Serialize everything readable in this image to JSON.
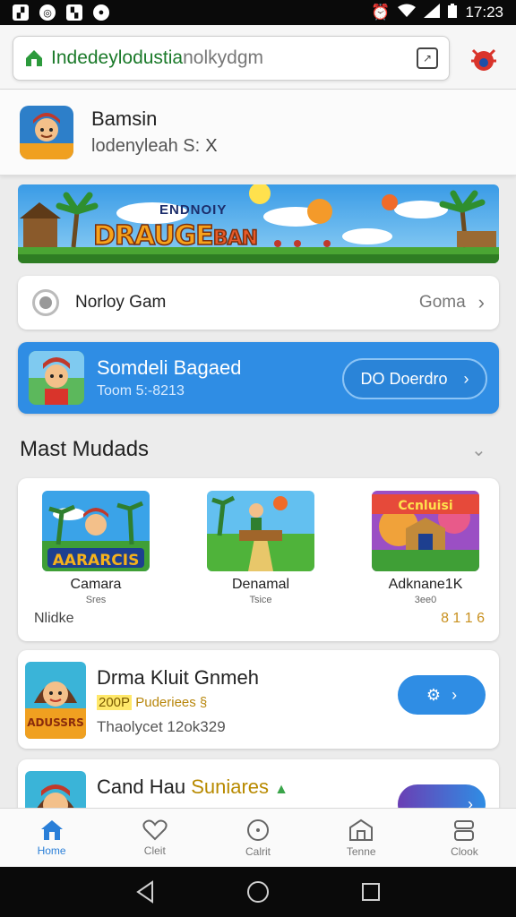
{
  "status_bar": {
    "time": "17:23"
  },
  "url_bar": {
    "url_main": "Indedeylodustia",
    "url_dim": "nolkydgm"
  },
  "app_header": {
    "name": "Bamsin",
    "subtitle": "lodenyleah S:",
    "close_glyph": "X"
  },
  "banner": {
    "top_text": "ENDNOIY",
    "title": "DRAUGE",
    "title_suffix": "BAN"
  },
  "gam_row": {
    "label": "Norloy Gam",
    "right_label": "Goma"
  },
  "promo": {
    "title": "Somdeli Bagaed",
    "subtitle": "Toom 5:-8213",
    "button_label": "DO Doerdro"
  },
  "section": {
    "title": "Mast Mudads"
  },
  "grid": {
    "items": [
      {
        "name": "Camara",
        "sub": "Sres",
        "thumb_text": "AARARCIS"
      },
      {
        "name": "Denamal",
        "sub": "Tsice",
        "thumb_text": ""
      },
      {
        "name": "Adknane1K",
        "sub": "3ee0",
        "thumb_text": "Ccnluisi"
      }
    ],
    "footer": "Nlidke",
    "rating": "8 1 1 6"
  },
  "list_items": [
    {
      "title": "Drma Kluit Gnmeh",
      "badge_highlight": "200P",
      "badge_rest": "Puderiees §",
      "subtitle": "Thaolycet 12ok329",
      "thumb_text": "ADUSSRS"
    },
    {
      "title": "Cand Hau ",
      "title_highlight": "Suniares",
      "title_tag": "▲"
    }
  ],
  "bottom_nav": [
    {
      "label": "Home",
      "icon": "home-icon",
      "active": true
    },
    {
      "label": "Cleit",
      "icon": "heart-icon",
      "active": false
    },
    {
      "label": "Calrit",
      "icon": "clock-icon",
      "active": false
    },
    {
      "label": "Tenne",
      "icon": "store-icon",
      "active": false
    },
    {
      "label": "Clook",
      "icon": "box-icon",
      "active": false
    }
  ],
  "colors": {
    "accent": "#2f8de4",
    "url_green": "#1b7a2a",
    "status_bar": "#0a0a0a"
  }
}
